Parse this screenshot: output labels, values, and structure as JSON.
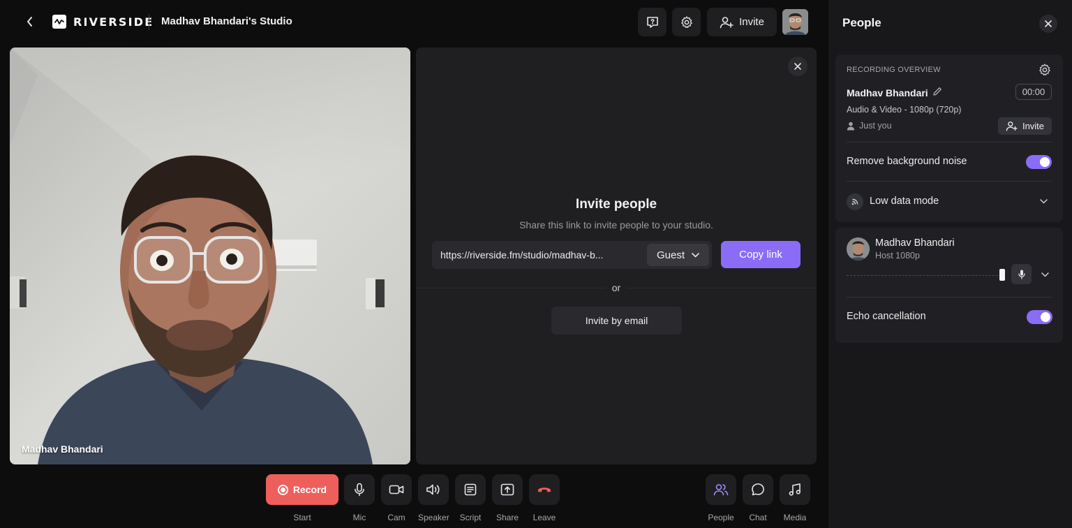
{
  "header": {
    "logo_text": "RIVERSIDE",
    "studio_title": "Madhav Bhandari's Studio",
    "invite_label": "Invite"
  },
  "video": {
    "participant_name": "Madhav Bhandari"
  },
  "invite_panel": {
    "title": "Invite people",
    "subtitle": "Share this link to invite people to your studio.",
    "link": "https://riverside.fm/studio/madhav-b...",
    "role_selected": "Guest",
    "copy_label": "Copy link",
    "or_label": "or",
    "email_label": "Invite by email"
  },
  "controls": {
    "record_label": "Record",
    "start_label": "Start",
    "mic": "Mic",
    "cam": "Cam",
    "speaker": "Speaker",
    "script": "Script",
    "share": "Share",
    "leave": "Leave",
    "people": "People",
    "chat": "Chat",
    "media": "Media"
  },
  "sidebar": {
    "title": "People",
    "overview_label": "RECORDING OVERVIEW",
    "recording_name": "Madhav Bhandari",
    "timer": "00:00",
    "spec": "Audio & Video - 1080p (720p)",
    "participants_summary": "Just you",
    "invite_label": "Invite",
    "noise_label": "Remove background noise",
    "noise_on": true,
    "low_data_label": "Low data mode",
    "participant": {
      "name": "Madhav Bhandari",
      "role": "Host",
      "quality": "1080p",
      "role_line": "Host  1080p"
    },
    "echo_label": "Echo cancellation",
    "echo_on": true,
    "mic_volume": 1.0
  },
  "colors": {
    "accent": "#8b6cf7",
    "record": "#ee5f5b",
    "background": "#0d0d0d",
    "panel": "#1f1f22",
    "sidebar": "#18181b"
  }
}
